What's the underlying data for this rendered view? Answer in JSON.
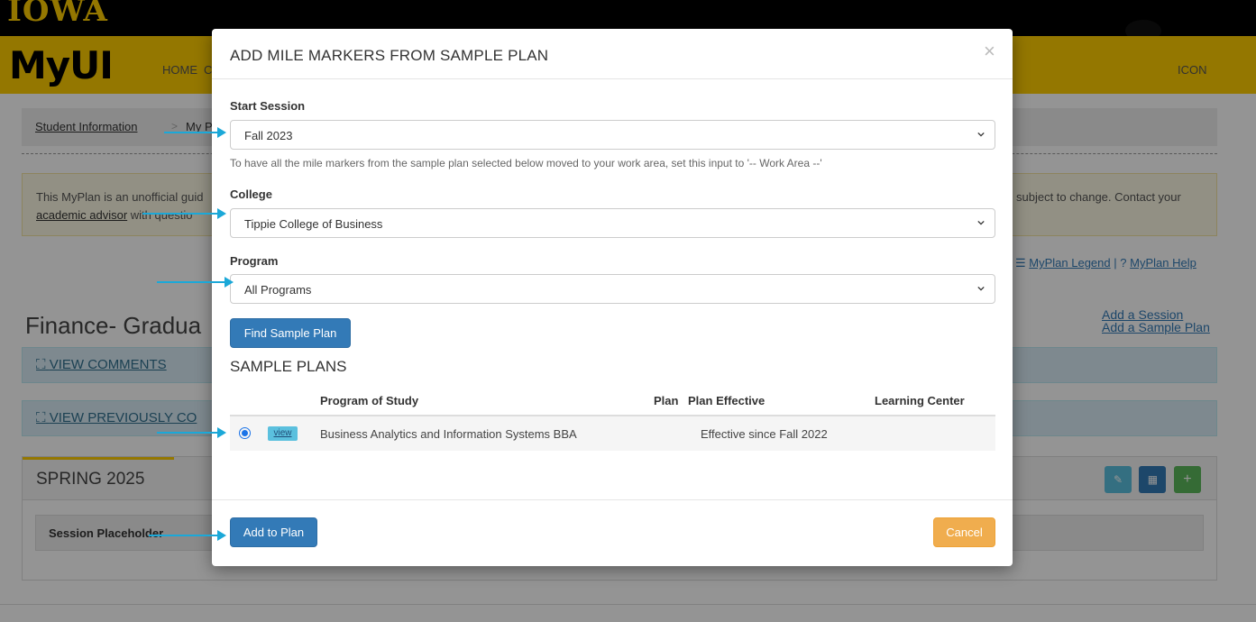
{
  "header": {
    "brand": "IOWA",
    "logo": "MyUI",
    "nav_home": "HOME",
    "nav_partial": "C",
    "nav_icon": "ICON"
  },
  "breadcrumb": {
    "item1": "Student Information",
    "item2": "My Plan"
  },
  "notice": {
    "line1": "This MyPlan is an unofficial guid",
    "line2_link": "academic advisor",
    "line2_rest": "with questio",
    "line1_right": "subject to change. Contact your"
  },
  "help_links": {
    "legend": "MyPlan Legend",
    "separator": "|",
    "help": "MyPlan Help"
  },
  "page": {
    "title": "Finance- Gradua",
    "add_session": "Add a Session",
    "add_sample_plan": "Add a Sample Plan",
    "view_comments": "VIEW COMMENTS",
    "view_previous": "VIEW PREVIOUSLY CO"
  },
  "session": {
    "title": "SPRING 2025",
    "placeholder": "Session Placeholder",
    "btn_colors": [
      "#5bc0de",
      "#337ab7",
      "#5cb85c"
    ],
    "btn_icons": [
      "edit-icon",
      "calendar-icon",
      "plus-icon"
    ]
  },
  "modal": {
    "title": "ADD MILE MARKERS FROM SAMPLE PLAN",
    "close_glyph": "×",
    "start_session_label": "Start Session",
    "start_session_value": "Fall 2023",
    "help_text": "To have all the mile markers from the sample plan selected below moved to your work area, set this input to '-- Work Area --'",
    "college_label": "College",
    "college_value": "Tippie College of Business",
    "program_label": "Program",
    "program_value": "All Programs",
    "find_button": "Find Sample Plan",
    "sample_plans_title": "SAMPLE PLANS",
    "table": {
      "headers": [
        "Program of Study",
        "Plan",
        "Plan Effective",
        "Learning Center"
      ],
      "rows": [
        {
          "selected": true,
          "view_label": "view",
          "program": "Business Analytics and Information Systems BBA",
          "plan": "",
          "effective": "Effective since Fall 2022",
          "learning_center": ""
        }
      ]
    },
    "add_button": "Add to Plan",
    "cancel_button": "Cancel"
  },
  "colors": {
    "brand_gold": "#FFCD00",
    "primary": "#337ab7",
    "warning": "#f0ad4e",
    "annotation_arrow": "#1ba8d8"
  }
}
